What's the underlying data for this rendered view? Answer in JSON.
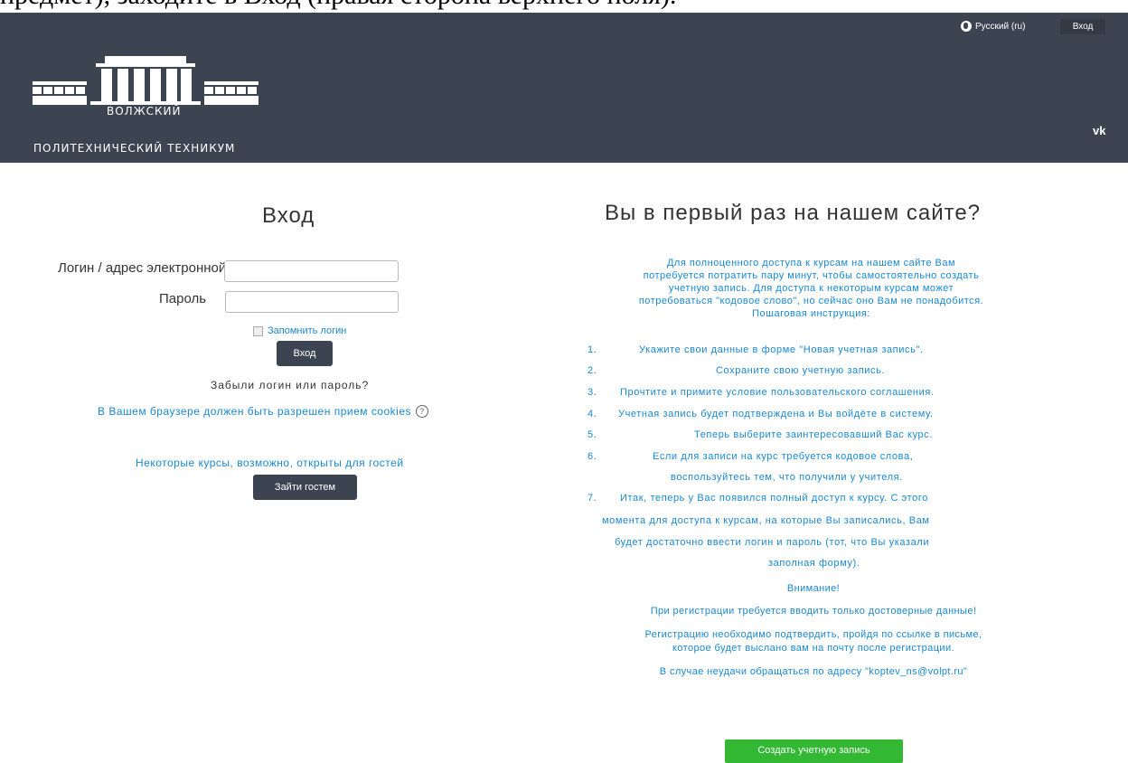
{
  "crop_text": "предмет), заходите в Вход (правая сторона верхнего поля).",
  "topbar": {
    "language": "Русский (ru)",
    "login_link": "Вход"
  },
  "header": {
    "logo_line1": "ВОЛЖСКИЙ",
    "logo_line2": "ПОЛИТЕХНИЧЕСКИЙ ТЕХНИКУМ",
    "social": "vk"
  },
  "login": {
    "title": "Вход",
    "username_label": "Логин / адрес электронной почты",
    "username_value": "",
    "password_label": "Пароль",
    "password_value": "",
    "remember": "Запомнить логин",
    "submit": "Вход",
    "forgot": "Забыли логин или пароль?",
    "cookies": "В Вашем браузере должен быть разрешен прием cookies",
    "guests_text": "Некоторые курсы, возможно, открыты для гостей",
    "guest_button": "Зайти гостем"
  },
  "signup": {
    "title": "Вы в первый раз на нашем сайте?",
    "intro_lines": [
      "Для полноценного доступа к курсам на нашем сайте Вам",
      "потребуется потратить пару минут, чтобы самостоятельно создать",
      "учетную запись. Для доступа к некоторым курсам может",
      "потребоваться \"кодовое слово\", но сейчас оно Вам не понадобится.",
      "Пошаговая инструкция:"
    ],
    "steps": [
      {
        "num": "1.",
        "text": "Укажите свои данные в форме \"Новая учетная запись\"."
      },
      {
        "num": "2.",
        "text": "Сохраните свою учетную запись."
      },
      {
        "num": "3.",
        "text": "Прочтите и примите условие пользовательского соглашения."
      },
      {
        "num": "4.",
        "text": "Учетная запись будет подтверждена и Вы войдёте в систему."
      },
      {
        "num": "5.",
        "text": "Теперь выберите заинтересовавший Вас курс."
      },
      {
        "num": "6.",
        "text": "Если для записи на курс требуется кодовое слова,"
      },
      {
        "num": "",
        "text": "воспользуйтесь тем, что получили у учителя."
      },
      {
        "num": "7.",
        "text": "Итак, теперь у Вас появился полный доступ к курсу. С этого"
      },
      {
        "num": "",
        "text": "момента для доступа к курсам, на которые Вы записались, Вам"
      },
      {
        "num": "",
        "text": "будет достаточно ввести логин и пароль (тот, что Вы указали"
      },
      {
        "num": "",
        "text": "заполная форму)."
      }
    ],
    "attention": "Внимание!",
    "note1": "При регистрации требуется вводить только достоверные данные!",
    "note2a": "Регистрацию необходимо подтвердить, пройдя по ссылке в письме,",
    "note2b": "которое будет выслано вам на почту после регистрации.",
    "note3": "В случае неудачи обращаться по адресу \"koptev_ns@volpt.ru\"",
    "create_button": "Создать учетную запись"
  }
}
